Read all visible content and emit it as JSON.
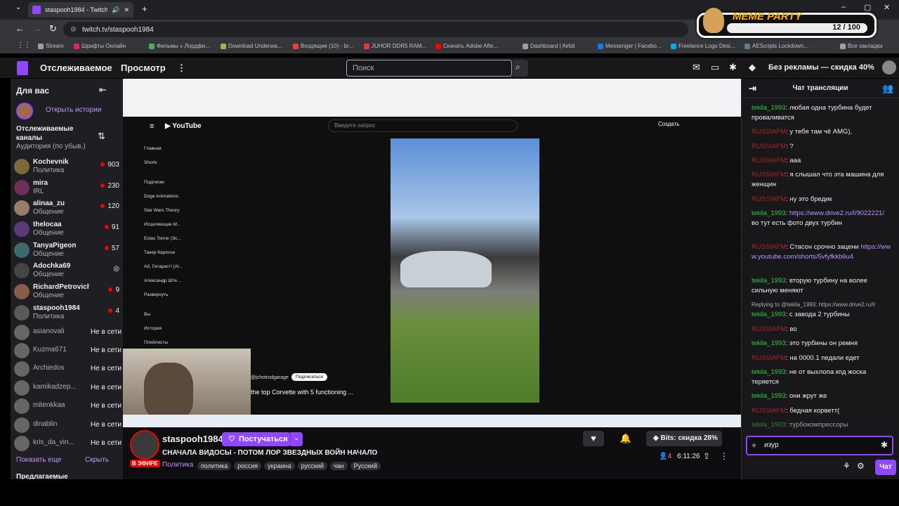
{
  "browser": {
    "tab_title": "staspooh1984 - Twitch",
    "url": "twitch.tv/staspooh1984",
    "bookmarks": [
      {
        "label": "Stream",
        "color": "#9aa0a6"
      },
      {
        "label": "Шрифты Онлайн",
        "color": "#e91e63"
      },
      {
        "label": "Фильмы » Лордфи...",
        "color": "#4caf50"
      },
      {
        "label": "Download Underwa...",
        "color": "#8bc34a"
      },
      {
        "label": "Входящие (10) - br...",
        "color": "#ea4335"
      },
      {
        "label": "JUHOR DDR5 RAM...",
        "color": "#e53935"
      },
      {
        "label": "Скачать Adobe Afte...",
        "color": "#ff0000"
      },
      {
        "label": "Dashboard | Airbit",
        "color": "#9aa0a6"
      },
      {
        "label": "Messenger | Facebo...",
        "color": "#1877f2"
      },
      {
        "label": "Freelance Logo Desi...",
        "color": "#03a9f4"
      },
      {
        "label": "AEScripts Lockdown...",
        "color": "#607d8b"
      },
      {
        "label": "Все закладки",
        "color": "#9aa0a6"
      }
    ]
  },
  "overlay": {
    "title": "MEME PARTY",
    "score": "12 / 100"
  },
  "nav": {
    "following": "Отслеживаемое",
    "browse": "Просмотр",
    "search_placeholder": "Поиск",
    "promo": "Без рекламы — скидка 40%"
  },
  "sidebar": {
    "for_you": "Для вас",
    "open_stories": "Открыть истории",
    "followed_title": "Отслеживаемые каналы",
    "sort_label": "Аудитория (по убыв.)",
    "channels": [
      {
        "name": "Kochevnik",
        "category": "Политика",
        "viewers": "903"
      },
      {
        "name": "mira",
        "category": "IRL",
        "viewers": "230"
      },
      {
        "name": "alinaa_zu",
        "category": "Общение",
        "viewers": "120"
      },
      {
        "name": "thelocaa",
        "category": "Общение",
        "viewers": "91"
      },
      {
        "name": "TanyaPigeon",
        "category": "Общение",
        "viewers": "57"
      },
      {
        "name": "Adochka69",
        "category": "Общение",
        "viewers": ""
      },
      {
        "name": "RichardPetrovich",
        "category": "Общение",
        "viewers": "9"
      },
      {
        "name": "staspooh1984",
        "category": "Политика",
        "viewers": "4"
      }
    ],
    "offline_channels": [
      "asianovali",
      "Kuzma671",
      "Archiedos",
      "kamikadzep...",
      "mitenkkaa",
      "dinablin",
      "kris_da_vin..."
    ],
    "offline_label": "Не в сети",
    "show_more": "Показать еще",
    "hide": "Скрыть",
    "recommended": "Предлагаемые"
  },
  "video": {
    "yt_search": "Введите запрос",
    "yt_create": "Создать",
    "yt_menu": [
      "Главная",
      "Shorts",
      "Подписки",
      "Doge Animations",
      "Star Wars Theory",
      "Исцеляющие М...",
      "Estas Tonne (Эс...",
      "Такер Карлсон",
      "Ай, Гитарист! [Al...",
      "Александр Ште...",
      "Развернуть",
      "Вы",
      "История",
      "Плейлисты"
    ],
    "yt_channel": "@jchotrodgarage",
    "yt_subscribe": "Подписаться",
    "yt_caption": "the top Corvette with 5 functioning ..."
  },
  "stream": {
    "streamer": "staspooh1984",
    "follow_label": "Постучаться",
    "title": "СНАЧАЛА ВИДОСЫ - ПОТОМ ЛОР ЗВЕЗДНЫХ ВОЙН НАЧАЛО",
    "live": "В ЭФИРЕ",
    "category": "Политика",
    "tags": [
      "политика",
      "россия",
      "украина",
      "русский",
      "чан",
      "Русский"
    ],
    "bits": "Bits: скидка 28%",
    "viewers": "4",
    "uptime": "6:11:26"
  },
  "chat": {
    "title": "Чат трансляции",
    "messages": [
      {
        "user": "tekila_1993",
        "color": "green",
        "text": ": любая одна турбина будет проваливатся"
      },
      {
        "user": "RUSSIAFM",
        "color": "red",
        "text": ": у тебя там чё AMG),"
      },
      {
        "user": "RUSSIAFM",
        "color": "red",
        "text": ": ?"
      },
      {
        "user": "RUSSIAFM",
        "color": "red",
        "text": ": ааа"
      },
      {
        "user": "RUSSIAFM",
        "color": "red",
        "text": ": я слышал что эта машина для женщин"
      },
      {
        "user": "RUSSIAFM",
        "color": "red",
        "text": ": ну это бредик"
      },
      {
        "user": "tekila_1993",
        "color": "green",
        "text": ": ",
        "link": "https://www.drive2.ru/l/9022221/",
        "after": " во тут есть фото двух турбин"
      },
      {
        "user": "RUSSIAFM",
        "color": "red",
        "text": ": Стасон срочно зацени ",
        "link": "https://www.youtube.com/shorts/5vfyfkkb6u4",
        "after": ""
      },
      {
        "user": "tekila_1993",
        "color": "green",
        "text": ": вторую турбину на волее сильную меняют"
      },
      {
        "reply": "Replying to @tekila_1993: https://www.drive2.ru/l/"
      },
      {
        "user": "tekila_1993",
        "color": "green",
        "text": ": с завода 2 турбины"
      },
      {
        "user": "RUSSIAFM",
        "color": "red",
        "text": ": во"
      },
      {
        "user": "tekila_1993",
        "color": "green",
        "text": ": это турбины он ремня"
      },
      {
        "user": "RUSSIAFM",
        "color": "red",
        "text": ": на 0000.1 педали едет"
      },
      {
        "user": "tekila_1993",
        "color": "green",
        "text": ": не от выхлопа кпд жоска теряется"
      },
      {
        "user": "tekila_1993",
        "color": "green",
        "text": ": они жрут же"
      },
      {
        "user": "RUSSIAFM",
        "color": "red",
        "text": ": бедная корветт("
      },
      {
        "user": "tekila_1993",
        "color": "green",
        "text": ": турбокомпрессоры"
      }
    ],
    "input_value": "изур",
    "send_label": "Чат"
  }
}
